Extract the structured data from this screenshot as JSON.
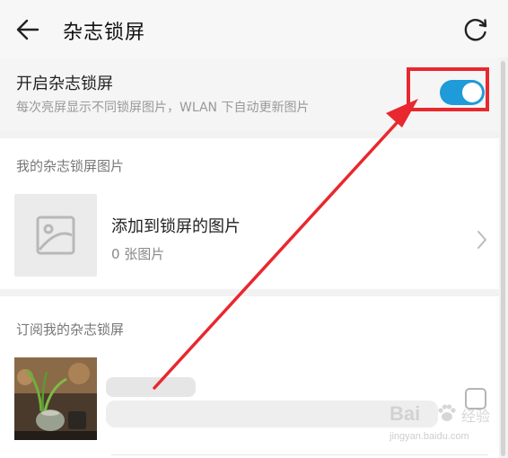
{
  "header": {
    "title": "杂志锁屏"
  },
  "magazine_toggle": {
    "title": "开启杂志锁屏",
    "subtitle": "每次亮屏显示不同锁屏图片，WLAN 下自动更新图片",
    "enabled": true
  },
  "my_magazine": {
    "section_label": "我的杂志锁屏图片",
    "add_title": "添加到锁屏的图片",
    "add_count": "0 张图片"
  },
  "subscriptions": {
    "section_label": "订阅我的杂志锁屏",
    "item_checked": false
  },
  "colors": {
    "accent": "#1e9bd8",
    "annotation_red": "#e8282e"
  },
  "watermark": {
    "logo": "Bai",
    "brand": "经验",
    "url": "jingyan.baidu.com"
  }
}
